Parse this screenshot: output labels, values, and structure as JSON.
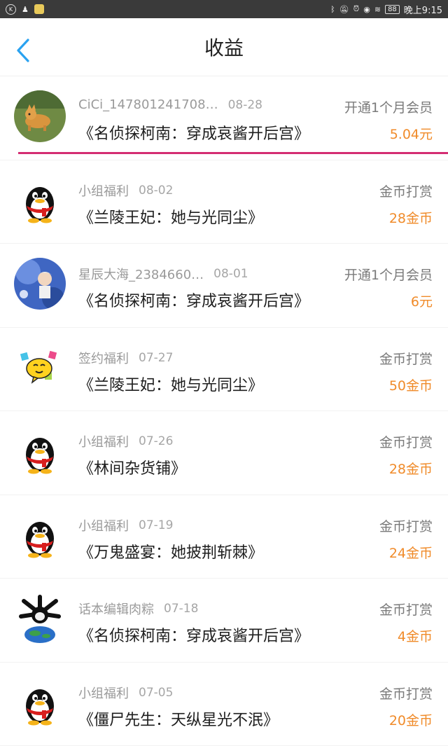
{
  "status_bar": {
    "left_icons": [
      "k-app-icon",
      "notification-icon",
      "app-icon"
    ],
    "battery": "88",
    "time": "晚上9:15"
  },
  "header": {
    "title": "收益"
  },
  "rows": [
    {
      "user": "CiCi_147801241708…",
      "date": "08-28",
      "type": "开通1个月会员",
      "work": "《名侦探柯南：穿成哀酱开后宫》",
      "amount": "5.04元",
      "avatar": "dog-photo"
    },
    {
      "user": "小组福利",
      "date": "08-02",
      "type": "金币打赏",
      "work": "《兰陵王妃：她与光同尘》",
      "amount": "28金币",
      "avatar": "qq-penguin"
    },
    {
      "user": "星辰大海_2384660…",
      "date": "08-01",
      "type": "开通1个月会员",
      "work": "《名侦探柯南：穿成哀酱开后宫》",
      "amount": "6元",
      "avatar": "anime-photo"
    },
    {
      "user": "签约福利",
      "date": "07-27",
      "type": "金币打赏",
      "work": "《兰陵王妃：她与光同尘》",
      "amount": "50金币",
      "avatar": "emoji"
    },
    {
      "user": "小组福利",
      "date": "07-26",
      "type": "金币打赏",
      "work": "《林间杂货铺》",
      "amount": "28金币",
      "avatar": "qq-penguin"
    },
    {
      "user": "小组福利",
      "date": "07-19",
      "type": "金币打赏",
      "work": "《万鬼盛宴：她披荆斩棘》",
      "amount": "24金币",
      "avatar": "qq-penguin"
    },
    {
      "user": "话本编辑肉粽",
      "date": "07-18",
      "type": "金币打赏",
      "work": "《名侦探柯南：穿成哀酱开后宫》",
      "amount": "4金币",
      "avatar": "earth-hand"
    },
    {
      "user": "小组福利",
      "date": "07-05",
      "type": "金币打赏",
      "work": "《僵尸先生：天纵星光不泯》",
      "amount": "20金币",
      "avatar": "qq-penguin"
    }
  ],
  "colors": {
    "accent": "#2aa2f0",
    "amount": "#f08b2a",
    "highlight": "#d42d72"
  }
}
